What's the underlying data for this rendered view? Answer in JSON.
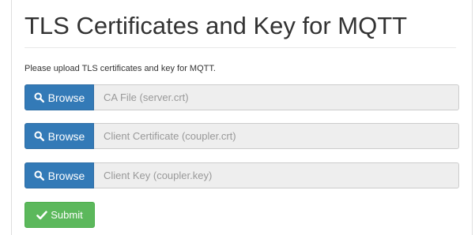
{
  "page": {
    "title": "TLS Certificates and Key for MQTT",
    "description": "Please upload TLS certificates and key for MQTT."
  },
  "uploads": [
    {
      "button_label": "Browse",
      "button_icon": "search-icon",
      "placeholder": "CA File (server.crt)"
    },
    {
      "button_label": "Browse",
      "button_icon": "search-icon",
      "placeholder": "Client Certificate (coupler.crt)"
    },
    {
      "button_label": "Browse",
      "button_icon": "search-icon",
      "placeholder": "Client Key (coupler.key)"
    }
  ],
  "submit": {
    "label": "Submit",
    "icon": "check-icon"
  },
  "colors": {
    "primary": "#337ab7",
    "success": "#5cb85c",
    "input_bg": "#eeeeee",
    "placeholder_text": "#999999"
  }
}
